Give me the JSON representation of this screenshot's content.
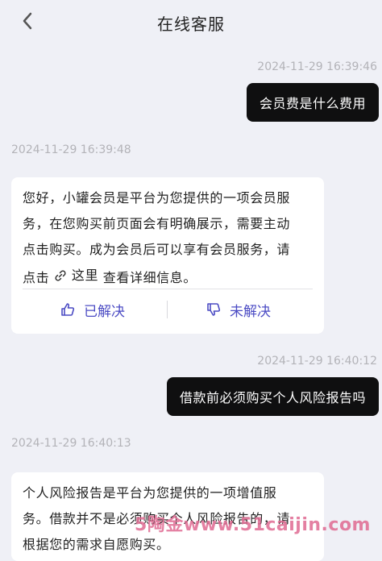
{
  "header": {
    "title": "在线客服"
  },
  "messages": {
    "m1": {
      "time": "2024-11-29 16:39:46",
      "text": "会员费是什么费用"
    },
    "m2": {
      "time": "2024-11-29 16:39:48",
      "line1": "您好，小罐会员是平台为您提供的一项会员服",
      "line2": "务，在您购买前页面会有明确展示，需要主动",
      "line3": "点击购买。成为会员后可以享有会员服务，请",
      "line4_prefix": "点击",
      "link_text": "这里",
      "line4_suffix": " 查看详细信息。",
      "resolved_label": "已解决",
      "unresolved_label": "未解决"
    },
    "m3": {
      "time": "2024-11-29 16:40:12",
      "text": "借款前必须购买个人风险报告吗"
    },
    "m4": {
      "time": "2024-11-29 16:40:13",
      "line1": "个人风险报告是平台为您提供的一项增值服",
      "line2": "务。借款并不是必须购买个人风险报告的，请",
      "line3": "根据您的需求自愿购买。"
    }
  },
  "watermark": "5陶金www.51caijin.com",
  "icons": [
    "back-chevron-icon",
    "link-icon",
    "thumbs-up-icon",
    "thumbs-down-icon"
  ]
}
